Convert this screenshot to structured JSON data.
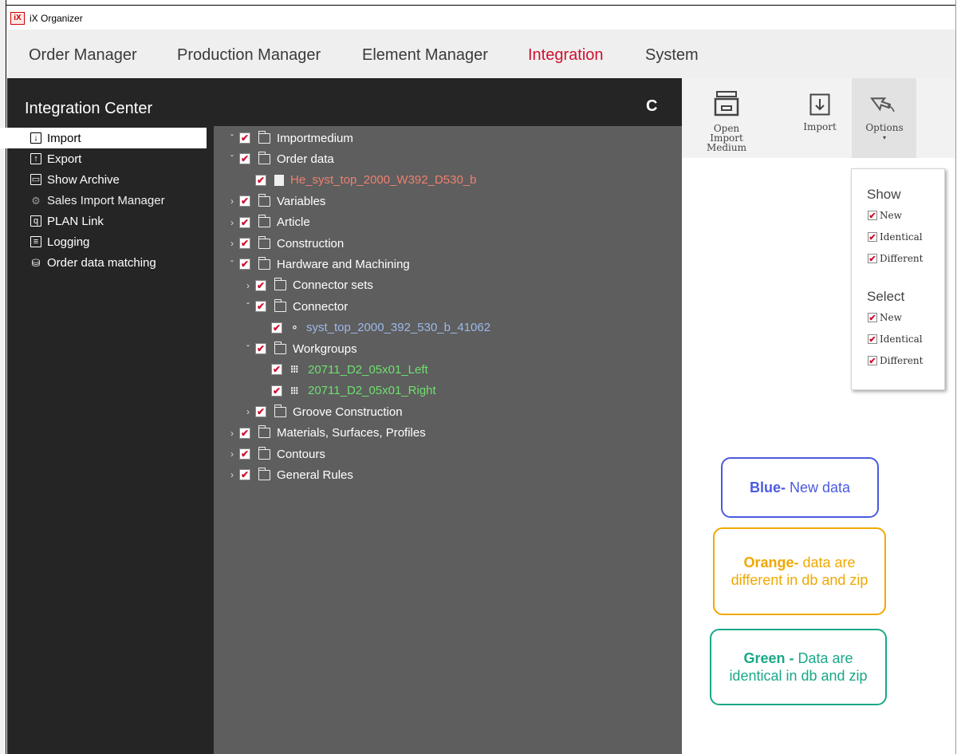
{
  "window": {
    "app_icon": "iX",
    "title": "iX Organizer"
  },
  "menu": [
    "Order Manager",
    "Production Manager",
    "Element Manager",
    "Integration",
    "System"
  ],
  "sidebar": {
    "title": "Integration Center",
    "refresh_icon": "C",
    "items": [
      {
        "label": "Import",
        "icon": "import-icon",
        "glyph": "↓"
      },
      {
        "label": "Export",
        "icon": "export-icon",
        "glyph": "↑"
      },
      {
        "label": "Show Archive",
        "icon": "archive-icon",
        "glyph": "▭"
      },
      {
        "label": "Sales Import Manager",
        "icon": "gears-icon",
        "glyph": "⚙"
      },
      {
        "label": "PLAN Link",
        "icon": "document-search-icon",
        "glyph": "q"
      },
      {
        "label": "Logging",
        "icon": "log-icon",
        "glyph": "≡"
      },
      {
        "label": "Order data matching",
        "icon": "database-icon",
        "glyph": "⛁"
      }
    ]
  },
  "tree": [
    {
      "label": "Importmedium",
      "chev": "ˇ",
      "kind": "folder",
      "color": "white"
    },
    {
      "label": "Order data",
      "chev": "ˇ",
      "kind": "folder",
      "color": "white"
    },
    {
      "label": "He_syst_top_2000_W392_D530_b",
      "chev": "",
      "kind": "file",
      "color": "orange"
    },
    {
      "label": "Variables",
      "chev": "›",
      "kind": "folder",
      "color": "white"
    },
    {
      "label": "Article",
      "chev": "›",
      "kind": "folder",
      "color": "white"
    },
    {
      "label": "Construction",
      "chev": "›",
      "kind": "folder",
      "color": "white"
    },
    {
      "label": "Hardware and Machining",
      "chev": "ˇ",
      "kind": "folder",
      "color": "white"
    },
    {
      "label": "Connector sets",
      "chev": "›",
      "kind": "folder",
      "color": "white"
    },
    {
      "label": "Connector",
      "chev": "ˇ",
      "kind": "folder",
      "color": "white"
    },
    {
      "label": "syst_top_2000_392_530_b_41062",
      "chev": "",
      "kind": "connector",
      "color": "blue"
    },
    {
      "label": "Workgroups",
      "chev": "ˇ",
      "kind": "folder",
      "color": "white"
    },
    {
      "label": "20711_D2_05x01_Left",
      "chev": "",
      "kind": "workgroup",
      "color": "green"
    },
    {
      "label": "20711_D2_05x01_Right",
      "chev": "",
      "kind": "workgroup",
      "color": "green"
    },
    {
      "label": "Groove Construction",
      "chev": "›",
      "kind": "folder",
      "color": "white"
    },
    {
      "label": "Materials, Surfaces, Profiles",
      "chev": "›",
      "kind": "folder",
      "color": "white"
    },
    {
      "label": "Contours",
      "chev": "›",
      "kind": "folder",
      "color": "white"
    },
    {
      "label": "General Rules",
      "chev": "›",
      "kind": "folder",
      "color": "white"
    }
  ],
  "toolbar": {
    "open_line1": "Open",
    "open_line2": "Import Medium",
    "import": "Import",
    "options": "Options",
    "options_caret": "▾"
  },
  "options_menu": {
    "show_heading": "Show",
    "select_heading": "Select",
    "show_items": [
      "New",
      "Identical",
      "Different"
    ],
    "select_items": [
      "New",
      "Identical",
      "Different"
    ]
  },
  "legend": {
    "blue": {
      "title": "Blue-",
      "text": " New data",
      "color": "#4a5ae0"
    },
    "orange": {
      "title": "Orange-",
      "text": " data are different in db and zip",
      "color": "#f0a800"
    },
    "green": {
      "title": "Green -",
      "text": " Data are identical in db and zip",
      "color": "#1aa888"
    }
  },
  "checkmark": "✔"
}
